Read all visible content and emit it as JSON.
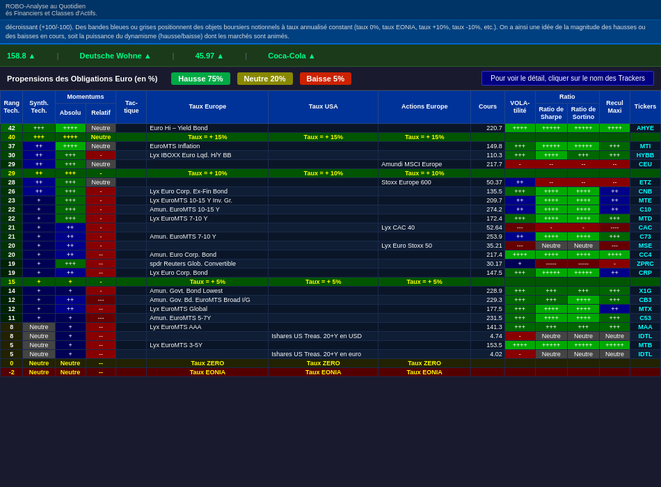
{
  "topBar": {
    "title": "ROBO-Analyse au Quotidien",
    "subtitle": "és Financiers et Classes d'Actifs."
  },
  "description": "décroissant (+100/-100). Des bandes bleues ou grises positionnent des objets boursiers notionnels à taux annualisé constant (taux 0%, taux EONIA, taux +10%, taux -10%, etc.). On a ainsi une idée de la magnitude des hausses ou des baisses en cours, soit la puissance du dynamisme (hausse/baisse) dont les marchés sont animés.",
  "tickers": [
    {
      "name": "158.8",
      "class": "pos"
    },
    {
      "name": "Deutsche Wohne",
      "class": "pos"
    },
    {
      "name": "45.97",
      "class": "pos"
    },
    {
      "name": "Coca-Cola",
      "class": "pos"
    }
  ],
  "propensions": {
    "label": "Propensions des Obligations Euro (en %)",
    "hausse": "Hausse 75%",
    "neutre": "Neutre 20%",
    "baisse": "Baisse 5%",
    "detailBtn": "Pour voir le détail, cliquer sur le nom des Trackers"
  },
  "tableHeaders": {
    "rang": "Rang Tech.",
    "synth": "Synth. Tech.",
    "momAbs": "Absolu",
    "momRel": "Relatif",
    "tac": "Tac- tique",
    "tauxEu": "Taux Europe",
    "tauxUs": "Taux USA",
    "actions": "Actions Europe",
    "cours": "Cours",
    "vol": "VOLA- tilité",
    "ratioSh": "Ratio de Sharpe",
    "ratioSo": "Ratio de Sortino",
    "recul": "Recul Maxi",
    "tickers": "Tickers"
  },
  "rows": [
    {
      "rang": "42",
      "synth": "+++",
      "momAbs": "++++",
      "momRel": "Neutre",
      "tac": "",
      "tauxEu": "Euro Hi – Yield Bond",
      "tauxUs": "",
      "actions": "",
      "cours": "220.7",
      "vol": "++++",
      "ratioSh": "+++++",
      "ratioSo": "+++++",
      "recul": "++++",
      "ticker": "AHYE",
      "rowClass": "row-dark"
    },
    {
      "rang": "40",
      "synth": "+++",
      "momAbs": "++++",
      "momRel": "Neutre",
      "tac": "",
      "tauxEu": "Taux = + 15%",
      "tauxUs": "Taux = + 15%",
      "actions": "Taux = + 15%",
      "cours": "",
      "vol": "",
      "ratioSh": "",
      "ratioSo": "",
      "recul": "",
      "ticker": "",
      "rowClass": "taux-row",
      "textClass": "text-yellow"
    },
    {
      "rang": "37",
      "synth": "++",
      "momAbs": "++++",
      "momRel": "Neutre",
      "tac": "",
      "tauxEu": "EuroMTS Inflation",
      "tauxUs": "",
      "actions": "",
      "cours": "149.8",
      "vol": "+++",
      "ratioSh": "+++++",
      "ratioSo": "+++++",
      "recul": "+++",
      "ticker": "MTI",
      "rowClass": "row-dark"
    },
    {
      "rang": "30",
      "synth": "++",
      "momAbs": "+++",
      "momRel": "-",
      "tac": "",
      "tauxEu": "Lyx IBOXX Euro Lqd. H/Y BB",
      "tauxUs": "",
      "actions": "",
      "cours": "110.3",
      "vol": "+++",
      "ratioSh": "++++",
      "ratioSo": "+++",
      "recul": "+++",
      "ticker": "HYBB",
      "rowClass": "row-mid"
    },
    {
      "rang": "29",
      "synth": "++",
      "momAbs": "+++",
      "momRel": "Neutre",
      "tac": "",
      "tauxEu": "",
      "tauxUs": "",
      "actions": "Amundi MSCI Europe",
      "cours": "217.7",
      "vol": "-",
      "ratioSh": "--",
      "ratioSo": "--",
      "recul": "--",
      "ticker": "CEU",
      "rowClass": "row-dark"
    },
    {
      "rang": "29",
      "synth": "++",
      "momAbs": "+++",
      "momRel": "-",
      "tac": "",
      "tauxEu": "Taux = + 10%",
      "tauxUs": "Taux = + 10%",
      "actions": "Taux = + 10%",
      "cours": "",
      "vol": "",
      "ratioSh": "",
      "ratioSo": "",
      "recul": "",
      "ticker": "",
      "rowClass": "taux-row",
      "textClass": "text-yellow"
    },
    {
      "rang": "28",
      "synth": "++",
      "momAbs": "+++",
      "momRel": "Neutre",
      "tac": "",
      "tauxEu": "",
      "tauxUs": "",
      "actions": "Stoxx Europe 600",
      "cours": "50.37",
      "vol": "++",
      "ratioSh": "--",
      "ratioSo": "--",
      "recul": "--",
      "ticker": "ETZ",
      "rowClass": "row-dark"
    },
    {
      "rang": "26",
      "synth": "++",
      "momAbs": "+++",
      "momRel": "-",
      "tac": "",
      "tauxEu": "Lyx Euro Corp. Ex-Fin Bond",
      "tauxUs": "",
      "actions": "",
      "cours": "135.5",
      "vol": "+++",
      "ratioSh": "++++",
      "ratioSo": "++++",
      "recul": "++",
      "ticker": "CNB",
      "rowClass": "row-mid"
    },
    {
      "rang": "23",
      "synth": "+",
      "momAbs": "+++",
      "momRel": "-",
      "tac": "",
      "tauxEu": "Lyx EuroMTS 10-15 Y Inv. Gr.",
      "tauxUs": "",
      "actions": "",
      "cours": "209.7",
      "vol": "++",
      "ratioSh": "++++",
      "ratioSo": "++++",
      "recul": "++",
      "ticker": "MTE",
      "rowClass": "row-dark"
    },
    {
      "rang": "22",
      "synth": "+",
      "momAbs": "+++",
      "momRel": "-",
      "tac": "",
      "tauxEu": "Amun. EuroMTS 10-15 Y",
      "tauxUs": "",
      "actions": "",
      "cours": "274.2",
      "vol": "++",
      "ratioSh": "++++",
      "ratioSo": "++++",
      "recul": "++",
      "ticker": "C10",
      "rowClass": "row-mid"
    },
    {
      "rang": "22",
      "synth": "+",
      "momAbs": "+++",
      "momRel": "-",
      "tac": "",
      "tauxEu": "Lyx EuroMTS 7-10 Y",
      "tauxUs": "",
      "actions": "",
      "cours": "172.4",
      "vol": "+++",
      "ratioSh": "++++",
      "ratioSo": "++++",
      "recul": "+++",
      "ticker": "MTD",
      "rowClass": "row-dark"
    },
    {
      "rang": "21",
      "synth": "+",
      "momAbs": "++",
      "momRel": "-",
      "tac": "",
      "tauxEu": "",
      "tauxUs": "",
      "actions": "Lyx CAC 40",
      "cours": "52.64",
      "vol": "---",
      "ratioSh": "-",
      "ratioSo": "-",
      "recul": "----",
      "ticker": "CAC",
      "rowClass": "row-mid"
    },
    {
      "rang": "21",
      "synth": "+",
      "momAbs": "++",
      "momRel": "-",
      "tac": "",
      "tauxEu": "Amun. EuroMTS 7-10 Y",
      "tauxUs": "",
      "actions": "",
      "cours": "253.9",
      "vol": "++",
      "ratioSh": "++++",
      "ratioSo": "++++",
      "recul": "+++",
      "ticker": "C73",
      "rowClass": "row-dark"
    },
    {
      "rang": "20",
      "synth": "+",
      "momAbs": "++",
      "momRel": "-",
      "tac": "",
      "tauxEu": "",
      "tauxUs": "",
      "actions": "Lyx Euro Stoxx 50",
      "cours": "35.21",
      "vol": "---",
      "ratioSh": "Neutre",
      "ratioSo": "Neutre",
      "recul": "---",
      "ticker": "MSE",
      "rowClass": "row-mid"
    },
    {
      "rang": "20",
      "synth": "+",
      "momAbs": "++",
      "momRel": "--",
      "tac": "",
      "tauxEu": "Amun. Euro Corp. Bond",
      "tauxUs": "",
      "actions": "",
      "cours": "217.4",
      "vol": "++++",
      "ratioSh": "++++",
      "ratioSo": "++++",
      "recul": "++++",
      "ticker": "CC4",
      "rowClass": "row-dark"
    },
    {
      "rang": "19",
      "synth": "+",
      "momAbs": "+++",
      "momRel": "--",
      "tac": "",
      "tauxEu": "spdr Reuters Glob. Convertible",
      "tauxUs": "",
      "actions": "",
      "cours": "30.17",
      "vol": "+",
      "ratioSh": "-----",
      "ratioSo": "-----",
      "recul": "-",
      "ticker": "ZPRC",
      "rowClass": "row-mid"
    },
    {
      "rang": "19",
      "synth": "+",
      "momAbs": "++",
      "momRel": "--",
      "tac": "",
      "tauxEu": "Lyx Euro Corp. Bond",
      "tauxUs": "",
      "actions": "",
      "cours": "147.5",
      "vol": "+++",
      "ratioSh": "+++++",
      "ratioSo": "+++++",
      "recul": "++",
      "ticker": "CRP",
      "rowClass": "row-dark"
    },
    {
      "rang": "15",
      "synth": "+",
      "momAbs": "+",
      "momRel": "-",
      "tac": "",
      "tauxEu": "Taux = + 5%",
      "tauxUs": "Taux = + 5%",
      "actions": "Taux = + 5%",
      "cours": "",
      "vol": "",
      "ratioSh": "",
      "ratioSo": "",
      "recul": "",
      "ticker": "",
      "rowClass": "taux-row",
      "textClass": "text-yellow"
    },
    {
      "rang": "14",
      "synth": "+",
      "momAbs": "+",
      "momRel": "-",
      "tac": "",
      "tauxEu": "Amun. Govt. Bond Lowest",
      "tauxUs": "",
      "actions": "",
      "cours": "228.9",
      "vol": "+++",
      "ratioSh": "+++",
      "ratioSo": "+++",
      "recul": "+++",
      "ticker": "X1G",
      "rowClass": "row-dark"
    },
    {
      "rang": "12",
      "synth": "+",
      "momAbs": "++",
      "momRel": "---",
      "tac": "",
      "tauxEu": "Amun. Gov. Bd. EuroMTS Broad I/G",
      "tauxUs": "",
      "actions": "",
      "cours": "229.3",
      "vol": "+++",
      "ratioSh": "+++",
      "ratioSo": "++++",
      "recul": "+++",
      "ticker": "CB3",
      "rowClass": "row-mid"
    },
    {
      "rang": "12",
      "synth": "+",
      "momAbs": "++",
      "momRel": "--",
      "tac": "",
      "tauxEu": "Lyx EuroMTS Global",
      "tauxUs": "",
      "actions": "",
      "cours": "177.5",
      "vol": "+++",
      "ratioSh": "++++",
      "ratioSo": "++++",
      "recul": "++",
      "ticker": "MTX",
      "rowClass": "row-dark"
    },
    {
      "rang": "11",
      "synth": "+",
      "momAbs": "+",
      "momRel": "---",
      "tac": "",
      "tauxEu": "Amun. EuroMTS 5-7Y",
      "tauxUs": "",
      "actions": "",
      "cours": "231.5",
      "vol": "+++",
      "ratioSh": "++++",
      "ratioSo": "++++",
      "recul": "+++",
      "ticker": "C53",
      "rowClass": "row-mid"
    },
    {
      "rang": "8",
      "synth": "Neutre",
      "momAbs": "+",
      "momRel": "--",
      "tac": "",
      "tauxEu": "Lyx EuroMTS AAA",
      "tauxUs": "",
      "actions": "",
      "cours": "141.3",
      "vol": "+++",
      "ratioSh": "+++",
      "ratioSo": "+++",
      "recul": "+++",
      "ticker": "MAA",
      "rowClass": "row-dark"
    },
    {
      "rang": "8",
      "synth": "Neutre",
      "momAbs": "+",
      "momRel": "--",
      "tac": "",
      "tauxEu": "",
      "tauxUs": "Ishares US Treas. 20+Y en USD",
      "actions": "",
      "cours": "4.74",
      "vol": "-",
      "ratioSh": "Neutre",
      "ratioSo": "Neutre",
      "recul": "Neutre",
      "ticker": "IDTL",
      "rowClass": "row-mid"
    },
    {
      "rang": "5",
      "synth": "Neutre",
      "momAbs": "+",
      "momRel": "--",
      "tac": "",
      "tauxEu": "Lyx EuroMTS 3-5Y",
      "tauxUs": "",
      "actions": "",
      "cours": "153.5",
      "vol": "++++",
      "ratioSh": "+++++",
      "ratioSo": "+++++",
      "recul": "+++++",
      "ticker": "MTB",
      "rowClass": "row-dark"
    },
    {
      "rang": "5",
      "synth": "Neutre",
      "momAbs": "+",
      "momRel": "--",
      "tac": "",
      "tauxEu": "",
      "tauxUs": "Ishares US Treas. 20+Y en euro",
      "actions": "",
      "cours": "4.02",
      "vol": "-",
      "ratioSh": "Neutre",
      "ratioSo": "Neutre",
      "recul": "Neutre",
      "ticker": "IDTL",
      "rowClass": "row-mid"
    },
    {
      "rang": "0",
      "synth": "Neutre",
      "momAbs": "Neutre",
      "momRel": "--",
      "tac": "",
      "tauxEu": "Taux ZERO",
      "tauxUs": "Taux ZERO",
      "actions": "Taux ZERO",
      "cours": "",
      "vol": "",
      "ratioSh": "",
      "ratioSo": "",
      "recul": "",
      "ticker": "",
      "rowClass": "taux-row-zero",
      "textClass": "text-yellow"
    },
    {
      "rang": "-2",
      "synth": "Neutre",
      "momAbs": "Neutre",
      "momRel": "--",
      "tac": "",
      "tauxEu": "Taux EONIA",
      "tauxUs": "Taux EONIA",
      "actions": "Taux EONIA",
      "cours": "",
      "vol": "",
      "ratioSh": "",
      "ratioSo": "",
      "recul": "",
      "ticker": "",
      "rowClass": "taux-row-eonia",
      "textClass": "text-yellow"
    }
  ]
}
